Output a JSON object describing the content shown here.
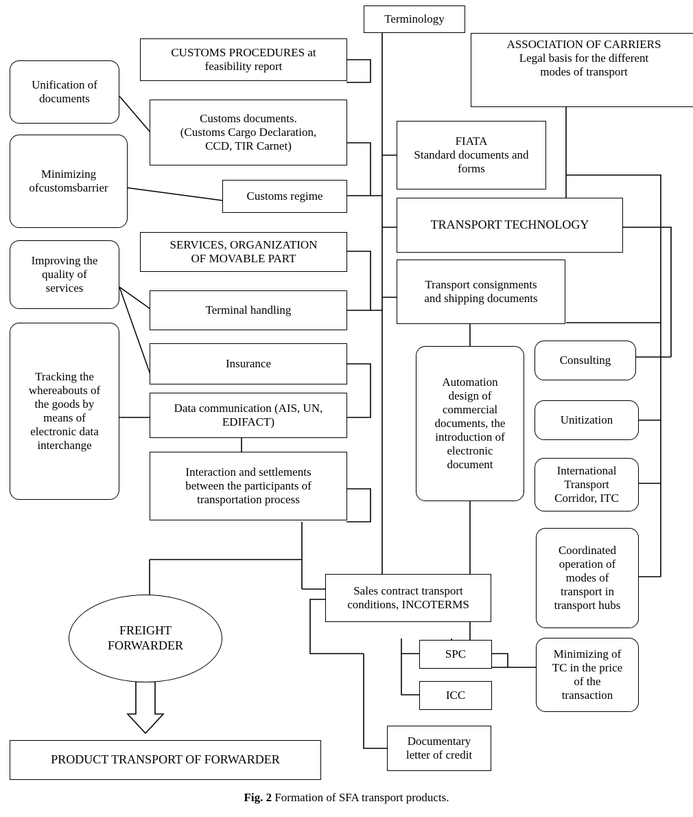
{
  "figure": {
    "caption_label": "Fig. 2",
    "caption_text": "Formation of SFA transport products."
  },
  "nodes": {
    "terminology": "Terminology",
    "association_of_carriers": "ASSOCIATION OF CARRIERS\nLegal basis for the different\nmodes of transport",
    "customs_procedures": "CUSTOMS PROCEDURES at\nfeasibility report",
    "customs_documents": "Customs documents.\n(Customs Cargo Declaration,\nCCD, TIR Carnet)",
    "customs_regime": "Customs regime",
    "services_organization": "SERVICES, ORGANIZATION\nOF MOVABLE PART",
    "terminal_handling": "Terminal handling",
    "insurance": "Insurance",
    "data_communication": "Data communication (AIS, UN,\nEDIFACT)",
    "interaction_settlements": "Interaction and settlements\nbetween the participants of\ntransportation process",
    "unification_of_documents": "Unification of\ndocuments",
    "minimizing_customs_barrier": "Minimizing\nofcustomsbarrier",
    "improving_quality": "Improving the\nquality of\nservices",
    "tracking_whereabouts": "Tracking the\nwhereabouts of\nthe goods by\nmeans of\nelectronic data\ninterchange",
    "fiata": "FIATA\nStandard documents and\nforms",
    "transport_technology": "TRANSPORT TECHNOLOGY",
    "transport_consignments": "Transport consignments\nand shipping documents",
    "automation_design": "Automation\ndesign of\ncommercial\ndocuments, the\nintroduction of\nelectronic\ndocument",
    "consulting": "Consulting",
    "unitization": "Unitization",
    "international_transport_corridor": "International\nTransport\nCorridor, ITC",
    "coordinated_operation": "Coordinated\noperation of\nmodes of\ntransport in\ntransport hubs",
    "minimizing_tc": "Minimizing of\nTC in the price\nof the\ntransaction",
    "freight_forwarder": "FREIGHT\nFORWARDER",
    "sales_contract": "Sales contract transport\nconditions, INCOTERMS",
    "spc": "SPC",
    "icc": "ICC",
    "documentary_letter": "Documentary\nletter of credit",
    "product_transport": "PRODUCT TRANSPORT OF FORWARDER"
  },
  "style": {
    "line_color": "#000000",
    "background": "#ffffff"
  }
}
